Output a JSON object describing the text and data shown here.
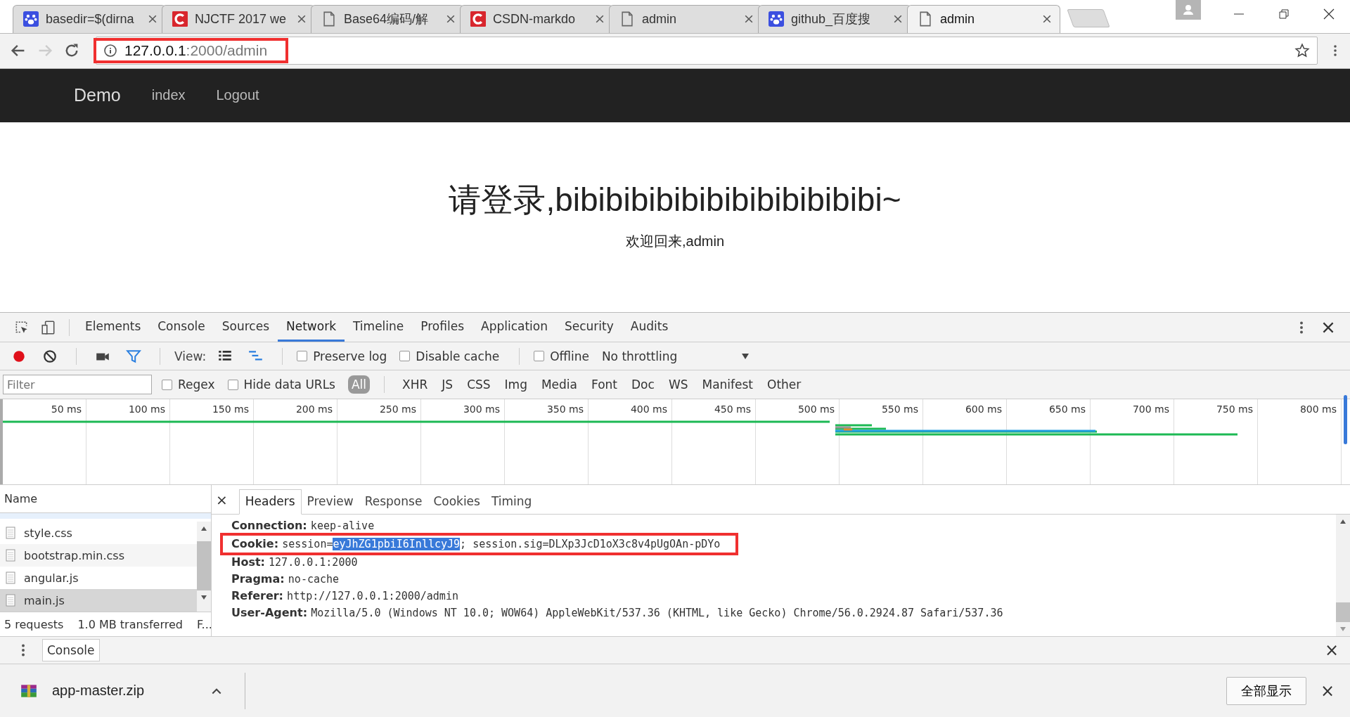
{
  "browser": {
    "tabs": [
      {
        "title": "basedir=$(dirna",
        "kind": "paw",
        "selected": false
      },
      {
        "title": "NJCTF 2017 we",
        "kind": "c-logo",
        "selected": false
      },
      {
        "title": "Base64编码/解",
        "kind": "page",
        "selected": false
      },
      {
        "title": "CSDN-markdo",
        "kind": "c-logo",
        "selected": false
      },
      {
        "title": "admin",
        "kind": "page",
        "selected": false
      },
      {
        "title": "github_百度搜",
        "kind": "paw",
        "selected": false
      },
      {
        "title": "admin",
        "kind": "page",
        "selected": true
      }
    ],
    "address": {
      "host": "127.0.0.1",
      "rest": ":2000/admin",
      "annotated": true
    }
  },
  "navbar": {
    "brand": "Demo",
    "links": [
      "index",
      "Logout"
    ]
  },
  "page": {
    "heading": "请登录,bibibibibibibibibibibibibi~",
    "subheading": "欢迎回来,admin"
  },
  "devtools": {
    "tabs": [
      {
        "label": "Elements",
        "selected": false
      },
      {
        "label": "Console",
        "selected": false
      },
      {
        "label": "Sources",
        "selected": false
      },
      {
        "label": "Network",
        "selected": true
      },
      {
        "label": "Timeline",
        "selected": false
      },
      {
        "label": "Profiles",
        "selected": false
      },
      {
        "label": "Application",
        "selected": false
      },
      {
        "label": "Security",
        "selected": false
      },
      {
        "label": "Audits",
        "selected": false
      }
    ],
    "toolbar": {
      "recording": true,
      "filter_active": true,
      "view_label": "View:",
      "checkboxes": [
        {
          "label": "Preserve log",
          "checked": false
        },
        {
          "label": "Disable cache",
          "checked": false
        },
        {
          "label": "Offline",
          "checked": false
        }
      ],
      "throttling": "No throttling"
    },
    "filter": {
      "placeholder": "Filter",
      "checkboxes": [
        {
          "label": "Regex",
          "checked": false
        },
        {
          "label": "Hide data URLs",
          "checked": false
        }
      ],
      "types": [
        {
          "label": "All",
          "selected": true
        },
        {
          "label": "XHR",
          "selected": false
        },
        {
          "label": "JS",
          "selected": false
        },
        {
          "label": "CSS",
          "selected": false
        },
        {
          "label": "Img",
          "selected": false
        },
        {
          "label": "Media",
          "selected": false
        },
        {
          "label": "Font",
          "selected": false
        },
        {
          "label": "Doc",
          "selected": false
        },
        {
          "label": "WS",
          "selected": false
        },
        {
          "label": "Manifest",
          "selected": false
        },
        {
          "label": "Other",
          "selected": false
        }
      ]
    },
    "timeline_ticks": [
      "50 ms",
      "100 ms",
      "150 ms",
      "200 ms",
      "250 ms",
      "300 ms",
      "350 ms",
      "400 ms",
      "450 ms",
      "500 ms",
      "550 ms",
      "600 ms",
      "650 ms",
      "700 ms",
      "750 ms",
      "800 ms"
    ],
    "requests": {
      "column": "Name",
      "rows": [
        {
          "name": "style.css",
          "selected": false
        },
        {
          "name": "bootstrap.min.css",
          "selected": false
        },
        {
          "name": "angular.js",
          "selected": false
        },
        {
          "name": "main.js",
          "selected": true
        }
      ],
      "summary": [
        "5 requests",
        "1.0 MB transferred",
        "F..."
      ]
    },
    "details": {
      "close": "×",
      "tabs": [
        {
          "label": "Headers",
          "selected": true
        },
        {
          "label": "Preview",
          "selected": false
        },
        {
          "label": "Response",
          "selected": false
        },
        {
          "label": "Cookies",
          "selected": false
        },
        {
          "label": "Timing",
          "selected": false
        }
      ],
      "headers": [
        {
          "name": "Connection:",
          "parts": [
            {
              "text": "keep-alive",
              "selected": false
            }
          ],
          "annotated": false
        },
        {
          "name": "Cookie:",
          "parts": [
            {
              "text": "session=",
              "selected": false
            },
            {
              "text": "eyJhZG1pbiI6InllcyJ9",
              "selected": true
            },
            {
              "text": "; session.sig=DLXp3JcD1oX3c8v4pUgOAn-pDYo",
              "selected": false
            }
          ],
          "annotated": true
        },
        {
          "name": "Host:",
          "parts": [
            {
              "text": "127.0.0.1:2000",
              "selected": false
            }
          ],
          "annotated": false
        },
        {
          "name": "Pragma:",
          "parts": [
            {
              "text": "no-cache",
              "selected": false
            }
          ],
          "annotated": false
        },
        {
          "name": "Referer:",
          "parts": [
            {
              "text": "http://127.0.0.1:2000/admin",
              "selected": false
            }
          ],
          "annotated": false
        },
        {
          "name": "User-Agent:",
          "parts": [
            {
              "text": "Mozilla/5.0 (Windows NT 10.0; WOW64) AppleWebKit/537.36 (KHTML, like Gecko) Chrome/56.0.2924.87 Safari/537.36",
              "selected": false
            }
          ],
          "annotated": false
        }
      ]
    },
    "drawer": {
      "tab": "Console",
      "close": "×"
    }
  },
  "downloads": {
    "file": "app-master.zip",
    "show_all": "全部显示",
    "close": "×"
  }
}
